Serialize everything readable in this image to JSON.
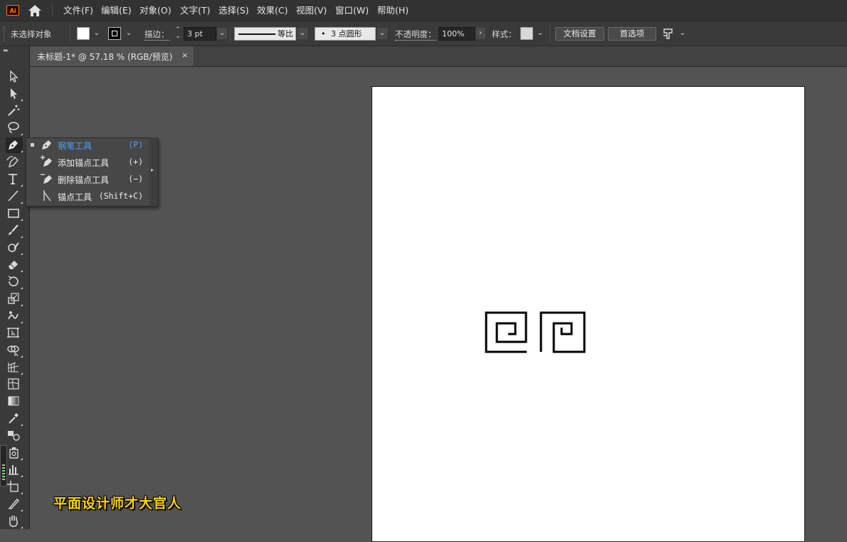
{
  "app": {
    "logo_text": "Ai"
  },
  "menu": [
    {
      "label": "文件(F)"
    },
    {
      "label": "编辑(E)"
    },
    {
      "label": "对象(O)"
    },
    {
      "label": "文字(T)"
    },
    {
      "label": "选择(S)"
    },
    {
      "label": "效果(C)"
    },
    {
      "label": "视图(V)"
    },
    {
      "label": "窗口(W)"
    },
    {
      "label": "帮助(H)"
    }
  ],
  "control_bar": {
    "selection_status": "未选择对象",
    "fill_color": "#ffffff",
    "stroke_color": "#000000",
    "stroke_label": "描边：",
    "stroke_weight": "3 pt",
    "profile_label": "等比",
    "brush_label": "3 点圆形",
    "brush_dot": "•",
    "opacity_label": "不透明度：",
    "opacity_value": "100%",
    "style_label": "样式：",
    "doc_setup_button": "文档设置",
    "preferences_button": "首选项"
  },
  "document": {
    "tab_title": "未标题-1* @ 57.18 % (RGB/预览)",
    "close_glyph": "×",
    "artboard_color": "#ffffff"
  },
  "flyout": {
    "items": [
      {
        "label": "钢笔工具",
        "shortcut": "(P)",
        "active": true,
        "icon": "pen-icon"
      },
      {
        "label": "添加锚点工具",
        "shortcut": "(+)",
        "active": false,
        "icon": "add-anchor-point-icon"
      },
      {
        "label": "删除锚点工具",
        "shortcut": "(−)",
        "active": false,
        "icon": "delete-anchor-point-icon"
      },
      {
        "label": "锚点工具",
        "shortcut": "(Shift+C)",
        "active": false,
        "icon": "anchor-point-icon"
      }
    ]
  },
  "tools": [
    "selection-tool",
    "direct-selection-tool",
    "magic-wand-tool",
    "lasso-tool",
    "pen-tool",
    "curvature-tool",
    "type-tool",
    "line-segment-tool",
    "rectangle-tool",
    "paintbrush-tool",
    "shaper-tool",
    "eraser-tool",
    "rotate-tool",
    "scale-tool",
    "warp-tool",
    "free-transform-tool",
    "shape-builder-tool",
    "perspective-grid-tool",
    "mesh-tool",
    "gradient-tool",
    "eyedropper-tool",
    "blend-tool",
    "symbol-sprayer-tool",
    "column-graph-tool",
    "artboard-tool",
    "slice-tool",
    "hand-tool"
  ],
  "watermark": "平面设计师才大官人",
  "accent_color": "#4e9fff"
}
